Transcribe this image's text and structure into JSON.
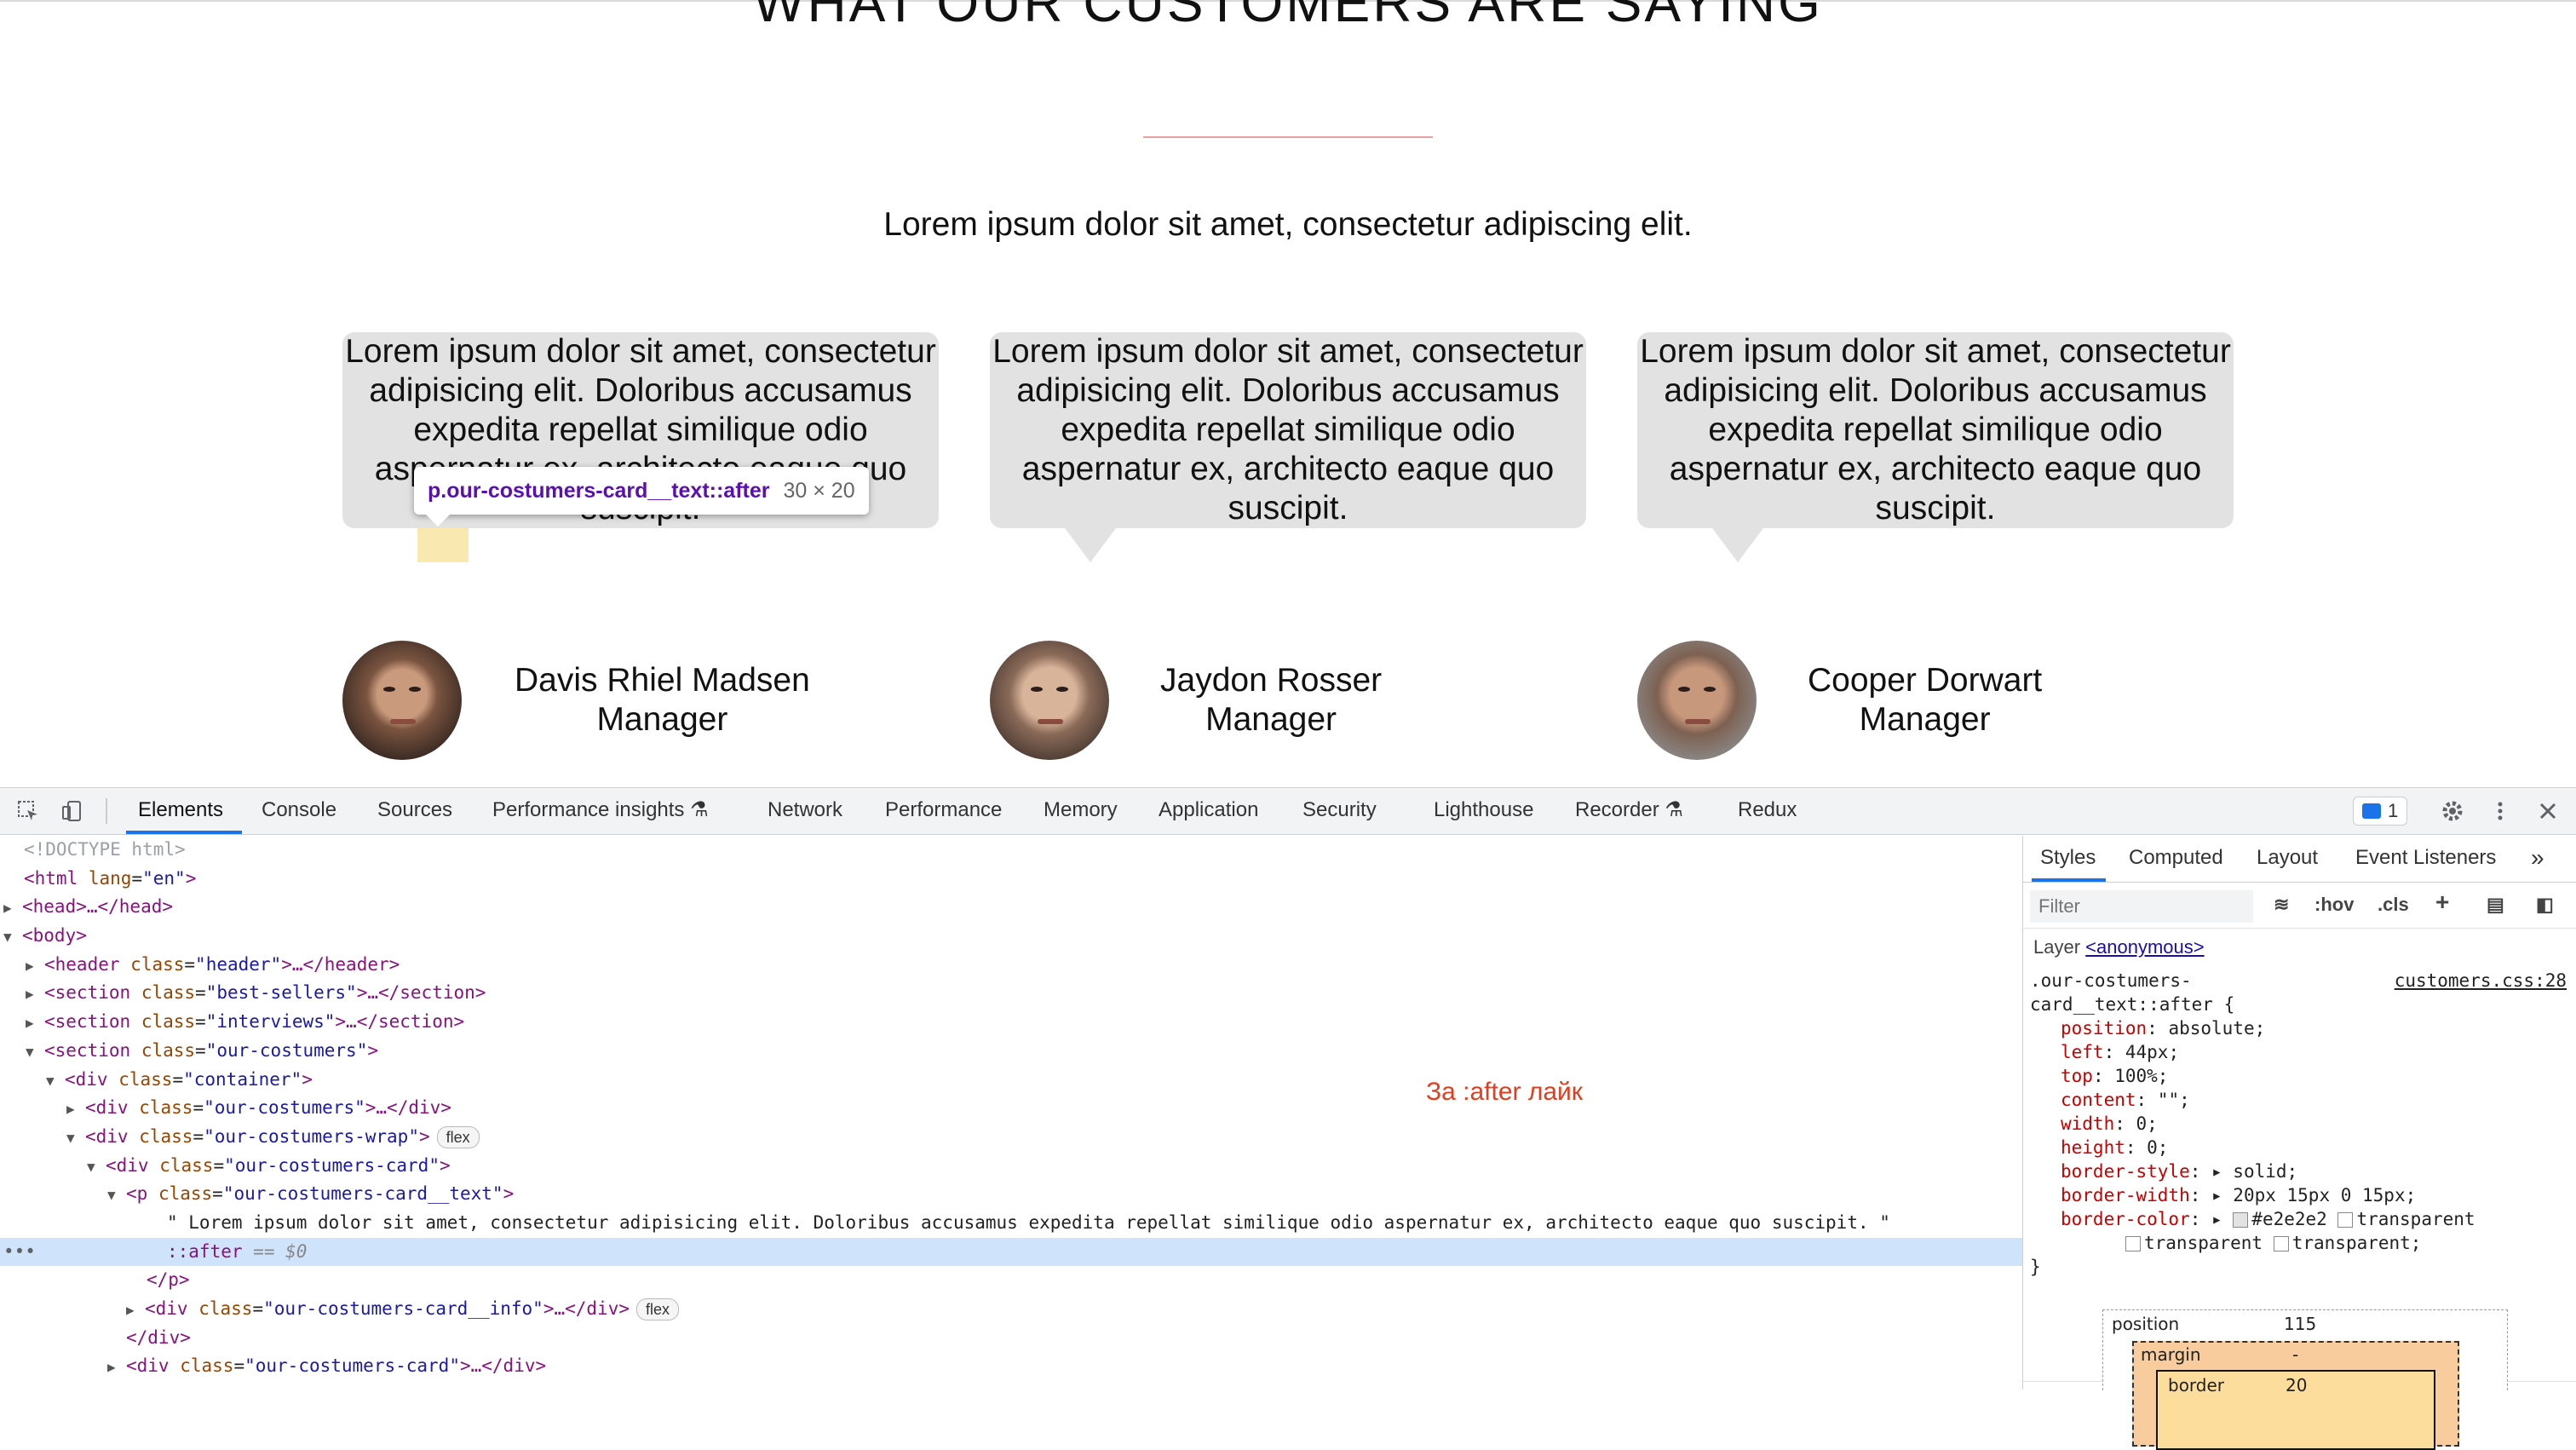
{
  "page": {
    "heading": "WHAT OUR CUSTOMERS ARE SAYING",
    "subtitle": "Lorem ipsum dolor sit amet, consectetur adipiscing elit.",
    "cards": [
      {
        "text": "Lorem ipsum dolor sit amet, consectetur adipisicing elit. Doloribus accusamus expedita repellat similique odio aspernatur ex, architecto eaque quo suscipit.",
        "name": "Davis Rhiel Madsen",
        "role": "Manager"
      },
      {
        "text": "Lorem ipsum dolor sit amet, consectetur adipisicing elit. Doloribus accusamus expedita repellat similique odio aspernatur ex, architecto eaque quo suscipit.",
        "name": "Jaydon Rosser",
        "role": "Manager"
      },
      {
        "text": "Lorem ipsum dolor sit amet, consectetur adipisicing elit. Doloribus accusamus expedita repellat similique odio aspernatur ex, architecto eaque quo suscipit.",
        "name": "Cooper Dorwart",
        "role": "Manager"
      }
    ],
    "tooltip": {
      "selector": "p.our-costumers-card__text::after",
      "size": "30 × 20"
    },
    "colors": {
      "card_bg": "#e2e2e2",
      "accent_line": "#e8a0a3",
      "tooltip_selector": "#5a0fb0"
    }
  },
  "devtools": {
    "tabs": [
      "Elements",
      "Console",
      "Sources",
      "Performance insights",
      "Network",
      "Performance",
      "Memory",
      "Application",
      "Security",
      "Lighthouse",
      "Recorder",
      "Redux"
    ],
    "active_tab": "Elements",
    "issues_count": "1",
    "dom_lines": {
      "doctype": "<!DOCTYPE html>",
      "html_open": "<html",
      "html_attr": "lang",
      "html_val": "\"en\"",
      "head": "<head>…</head>",
      "body": "<body>",
      "header_tag": "<header",
      "header_val": "\"header\"",
      "header_close": ">…</header>",
      "bs_tag": "<section",
      "bs_val": "\"best-sellers\"",
      "bs_close": ">…</section>",
      "iv_tag": "<section",
      "iv_val": "\"interviews\"",
      "iv_close": ">…</section>",
      "oc_tag": "<section",
      "oc_val": "\"our-costumers\"",
      "oc_close": ">",
      "cont_tag": "<div",
      "cont_val": "\"container\"",
      "cont_close": ">",
      "ocd_tag": "<div",
      "ocd_val": "\"our-costumers\"",
      "ocd_close": ">…</div>",
      "wrap_tag": "<div",
      "wrap_val": "\"our-costumers-wrap\"",
      "wrap_close": ">",
      "card_tag": "<div",
      "card_val": "\"our-costumers-card\"",
      "card_close": ">",
      "p_tag": "<p",
      "p_val": "\"our-costumers-card__text\"",
      "p_close": ">",
      "p_text": "\" Lorem ipsum dolor sit amet, consectetur adipisicing elit. Doloribus accusamus expedita repellat similique odio aspernatur ex, architecto eaque quo suscipit. \"",
      "after": "::after",
      "after_eq": "== $0",
      "p_end": "</p>",
      "info_tag": "<div",
      "info_val": "\"our-costumers-card__info\"",
      "info_close": ">…</div>",
      "div_end": "</div>",
      "card2_tag": "<div",
      "card2_val": "\"our-costumers-card\"",
      "card2_close": ">…</div>",
      "class_attr": "class",
      "flex_badge": "flex"
    },
    "annotation": "За :after лайк",
    "styles_tabs": [
      "Styles",
      "Computed",
      "Layout",
      "Event Listeners"
    ],
    "filter_placeholder": "Filter",
    "hov": ":hov",
    "cls": ".cls",
    "layer_label": "Layer",
    "layer_link": "<anonymous>",
    "rule_selector_1": ".our-costumers-",
    "rule_selector_2": "card__text::after {",
    "rule_source": "customers.css:28",
    "props": [
      {
        "name": "position",
        "value": "absolute;"
      },
      {
        "name": "left",
        "value": "44px;"
      },
      {
        "name": "top",
        "value": "100%;"
      },
      {
        "name": "content",
        "value": "\"\";"
      },
      {
        "name": "width",
        "value": "0;"
      },
      {
        "name": "height",
        "value": "0;"
      },
      {
        "name": "border-style",
        "value": "solid;"
      },
      {
        "name": "border-width",
        "value": "20px 15px 0 15px;"
      }
    ],
    "border_color_name": "border-color",
    "border_color_val1": "#e2e2e2",
    "border_color_val2": "transparent",
    "border_color_val3": "transparent",
    "border_color_val4": "transparent;",
    "rule_close": "}",
    "box_model": {
      "position_label": "position",
      "position_val": "115",
      "margin_label": "margin",
      "margin_val": "-",
      "border_label": "border",
      "border_val": "20"
    }
  }
}
